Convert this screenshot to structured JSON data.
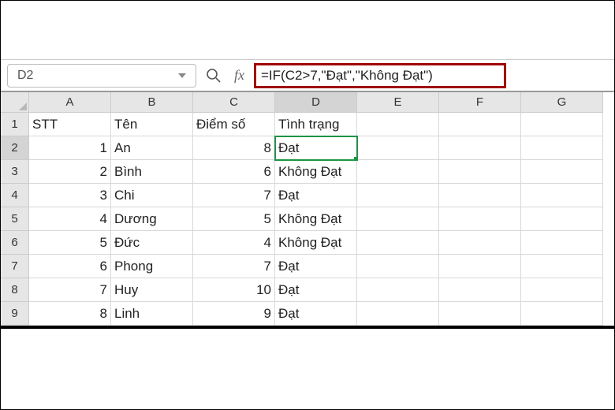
{
  "namebox": {
    "value": "D2"
  },
  "formula_bar": {
    "formula": "=IF(C2>7,\"Đạt\",\"Không Đạt\")",
    "fx_label": "fx"
  },
  "columns": [
    "A",
    "B",
    "C",
    "D",
    "E",
    "F",
    "G"
  ],
  "active_col": "D",
  "active_row": "2",
  "headers": {
    "A": "STT",
    "B": "Tên",
    "C": "Điểm số",
    "D": "Tình trạng"
  },
  "rows": [
    {
      "n": "1",
      "stt": "1",
      "ten": "An",
      "diem": "8",
      "tt": "Đạt"
    },
    {
      "n": "2",
      "stt": "2",
      "ten": "Bình",
      "diem": "6",
      "tt": "Không Đạt"
    },
    {
      "n": "3",
      "stt": "3",
      "ten": "Chi",
      "diem": "7",
      "tt": "Đạt"
    },
    {
      "n": "4",
      "stt": "4",
      "ten": "Dương",
      "diem": "5",
      "tt": "Không Đạt"
    },
    {
      "n": "5",
      "stt": "5",
      "ten": "Đức",
      "diem": "4",
      "tt": "Không Đạt"
    },
    {
      "n": "6",
      "stt": "6",
      "ten": "Phong",
      "diem": "7",
      "tt": "Đạt"
    },
    {
      "n": "7",
      "stt": "7",
      "ten": "Huy",
      "diem": "10",
      "tt": "Đạt"
    },
    {
      "n": "8",
      "stt": "8",
      "ten": "Linh",
      "diem": "9",
      "tt": "Đạt"
    }
  ]
}
